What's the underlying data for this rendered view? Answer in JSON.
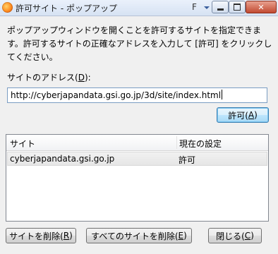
{
  "window": {
    "title": "許可サイト - ポップアップ",
    "title_extra": "F",
    "icon": "firefox-icon"
  },
  "description": "ポップアップウィンドウを開くことを許可するサイトを指定できます。許可するサイトの正確なアドレスを入力して [許可] をクリックしてください。",
  "address": {
    "label_prefix": "サイトのアドレス(",
    "label_key": "D",
    "label_suffix": "):",
    "value": "http://cyberjapandata.gsi.go.jp/3d/site/index.html"
  },
  "allow_button": {
    "prefix": "許可(",
    "key": "A",
    "suffix": ")"
  },
  "list": {
    "columns": [
      "サイト",
      "現在の設定"
    ],
    "rows": [
      {
        "site": "cyberjapandata.gsi.go.jp",
        "setting": "許可"
      }
    ]
  },
  "buttons": {
    "remove": {
      "prefix": "サイトを削除(",
      "key": "R",
      "suffix": ")"
    },
    "remove_all": {
      "prefix": "すべてのサイトを削除(",
      "key": "E",
      "suffix": ")"
    },
    "close": {
      "prefix": "閉じる(",
      "key": "C",
      "suffix": ")"
    }
  }
}
